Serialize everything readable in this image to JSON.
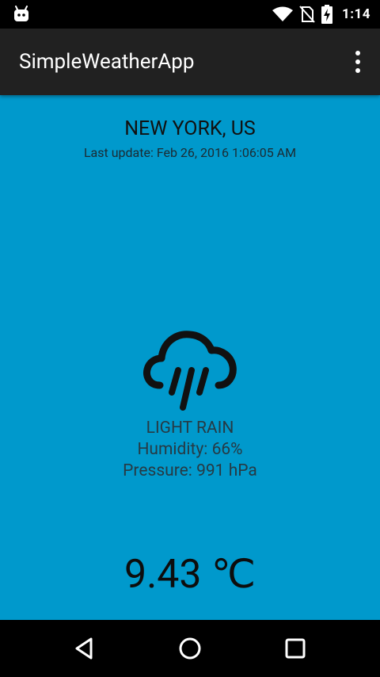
{
  "status_bar": {
    "time": "1:14",
    "icons": [
      "android-debug-icon",
      "wifi-icon",
      "no-sim-icon",
      "battery-charging-icon"
    ]
  },
  "app_bar": {
    "title": "SimpleWeatherApp",
    "menu_icon": "overflow-menu-icon"
  },
  "weather": {
    "location": "NEW YORK, US",
    "last_update": "Last update: Feb 26, 2016 1:06:05 AM",
    "icon": "rain-cloud-icon",
    "condition": "LIGHT RAIN",
    "humidity": "Humidity: 66%",
    "pressure": "Pressure: 991 hPa",
    "temperature": "9.43 ℃"
  },
  "nav_bar": {
    "buttons": [
      "back-icon",
      "home-icon",
      "recents-icon"
    ]
  },
  "colors": {
    "background": "#0099cc",
    "app_bar": "#212121",
    "status_bar": "#000000"
  }
}
